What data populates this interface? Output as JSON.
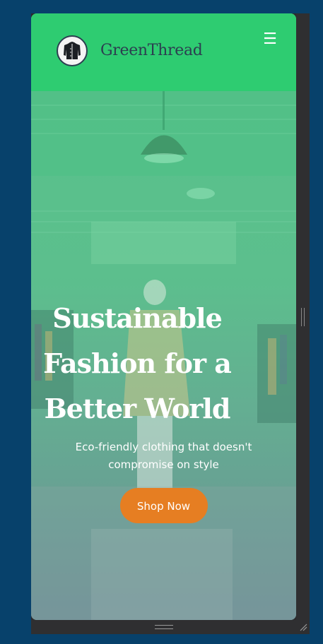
{
  "brand": {
    "name": "GreenThread",
    "logo_icon": "jacket-icon"
  },
  "nav": {
    "menu_icon": "hamburger-menu-icon"
  },
  "hero": {
    "title": "Sustainable Fashion for a Better World",
    "subtitle": "Eco-friendly clothing that doesn't compromise on style",
    "cta_label": "Shop Now"
  },
  "colors": {
    "navbar": "#2ecc71",
    "brand_text": "#2c3e50",
    "cta": "#e67e22",
    "background": "#07416b"
  }
}
